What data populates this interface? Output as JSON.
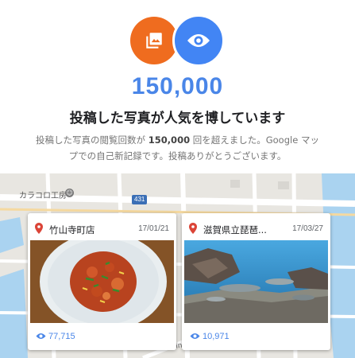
{
  "header": {
    "photos_icon": "photo-library-icon",
    "views_icon": "eye-icon",
    "view_count": "150,000",
    "headline": "投稿した写真が人気を博しています",
    "description_before": "投稿した写真の閲覧回数が ",
    "description_bold": "150,000",
    "description_after": " 回を超えました。Google マップでの自己新記録です。投稿ありがとうございます。"
  },
  "map": {
    "place_label": "カラコロ工房",
    "place_icon": "landmark-icon",
    "road_number": "431",
    "street_label": "Main Ln."
  },
  "cards": [
    {
      "title": "竹山寺町店",
      "date": "17/01/21",
      "photo": "food-dish-photo",
      "views": "77,715"
    },
    {
      "title": "滋賀県立琵琶...",
      "date": "17/03/27",
      "photo": "aquarium-photo",
      "views": "10,971"
    }
  ],
  "colors": {
    "orange": "#ef6c1f",
    "blue": "#4285f4",
    "number_blue": "#4a86e8",
    "pin_red": "#db4437"
  }
}
